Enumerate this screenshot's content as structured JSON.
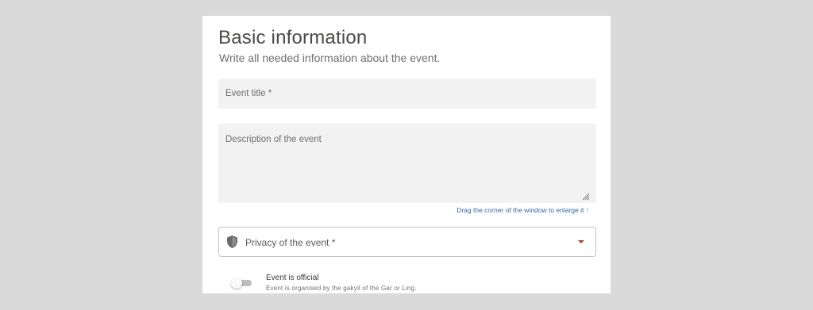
{
  "section": {
    "title": "Basic information",
    "subtitle": "Write all needed information about the event."
  },
  "fields": {
    "event_title_label": "Event title *",
    "description_label": "Description of the event",
    "resize_hint": "Drag the corner of the window to enlarge it ↑"
  },
  "privacy": {
    "label": "Privacy of the event *",
    "icon": "shield-icon",
    "caret_color": "#c0392b"
  },
  "official": {
    "label": "Event is official",
    "description": "Event is organised by the gakyil of the Gar or Ling.",
    "enabled": false
  }
}
